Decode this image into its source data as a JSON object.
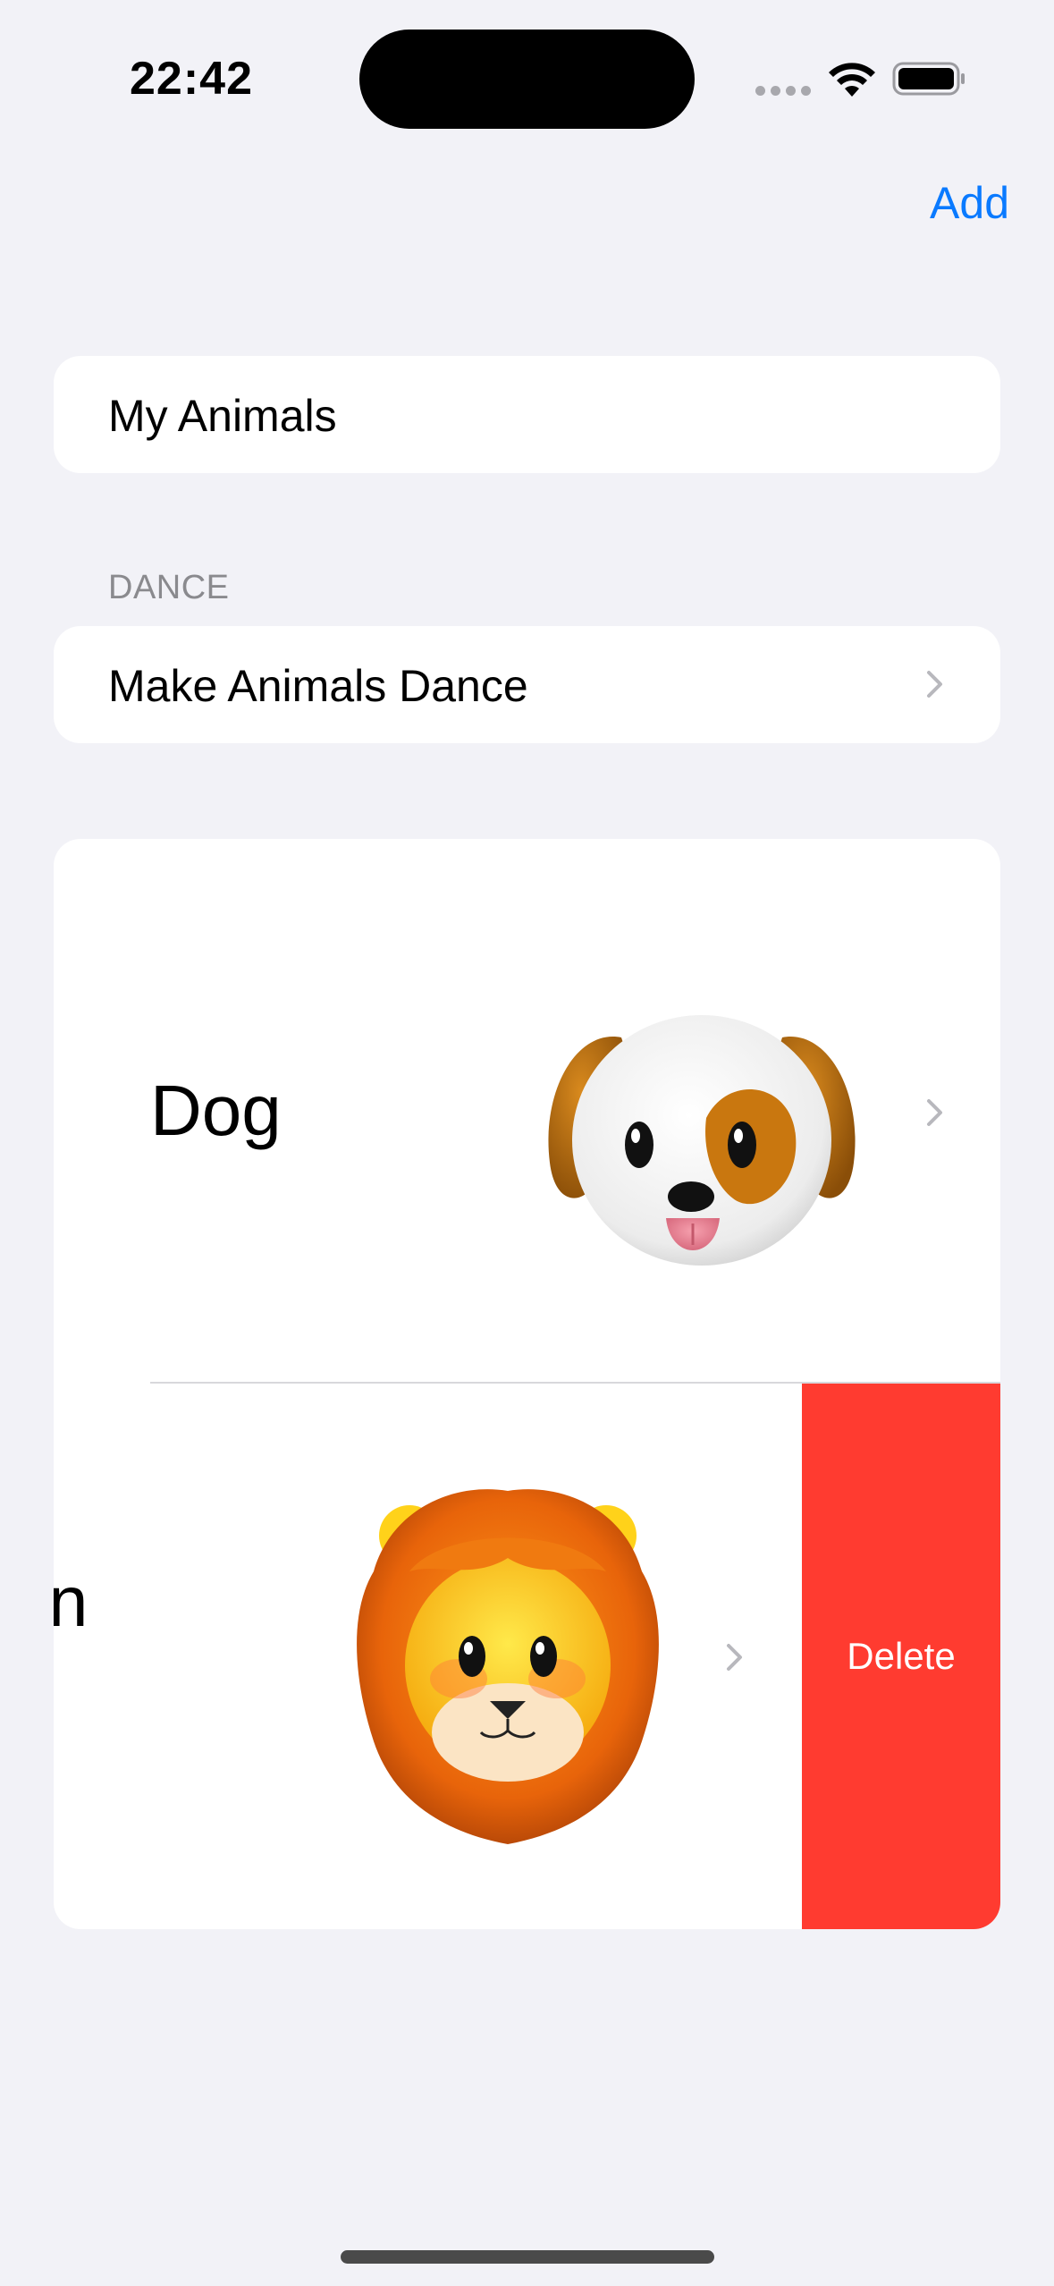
{
  "status_bar": {
    "time": "22:42"
  },
  "nav": {
    "add_label": "Add"
  },
  "title_field": {
    "value": "My Animals"
  },
  "dance_section": {
    "header": "DANCE",
    "item_label": "Make Animals Dance"
  },
  "animals": [
    {
      "name": "Dog",
      "emoji": "dog-face"
    },
    {
      "name": "n",
      "emoji": "lion-face",
      "swipe_action": "Delete"
    }
  ],
  "colors": {
    "accent": "#0a7aff",
    "destructive": "#ff3b30",
    "background": "#f2f2f7"
  }
}
